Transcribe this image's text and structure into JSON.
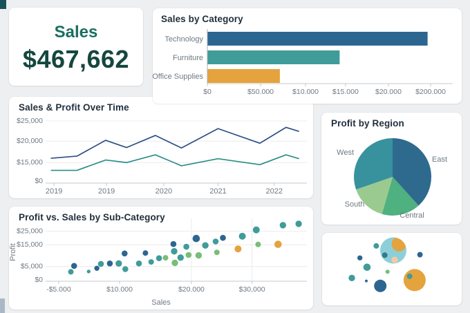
{
  "colors": {
    "darkblue": "#2d6591",
    "teal": "#3f9c98",
    "green": "#79bd77",
    "orange": "#e5a33d",
    "cyan": "#8ccfd9",
    "peach": "#f4caa2",
    "darkteal": "#35798c",
    "navy_line": "#2b4f85",
    "teal_line": "#2a8f86",
    "kpi_label": "#1c6f5f",
    "kpi_value": "#15473f"
  },
  "chart_data": [
    {
      "id": "kpi-sales",
      "type": "kpi",
      "title": "Sales",
      "value": "$467,662"
    },
    {
      "id": "sales-by-category",
      "type": "bar",
      "orientation": "horizontal",
      "title": "Sales by Category",
      "categories": [
        "Technology",
        "Furniture",
        "Office Supplies"
      ],
      "values": [
        195000,
        117000,
        64000
      ],
      "bar_colors": [
        "darkblue",
        "teal",
        "orange"
      ],
      "xlim": [
        0,
        217600
      ],
      "x_tick_labels": [
        "$0",
        "$50.000",
        "$10.000",
        "$15.000",
        "$20.000",
        "$200.000"
      ],
      "grid": false
    },
    {
      "id": "sales-profit-over-time",
      "type": "line",
      "title": "Sales & Profit Over Time",
      "x_tick_labels": [
        "2019",
        "2019",
        "2020",
        "2021",
        "2022"
      ],
      "y_tick_labels": [
        "$25,000",
        "$20,000",
        "$15,000",
        "$0"
      ],
      "y_tick_values": [
        25000,
        20000,
        15000,
        0
      ],
      "series": [
        {
          "name": "Sales",
          "color": "navy_line",
          "values": [
            16000,
            16500,
            20200,
            18500,
            21400,
            18400,
            23100,
            19500,
            23400,
            22400
          ]
        },
        {
          "name": "Profit",
          "color": "teal_line",
          "values": [
            8700,
            8700,
            15600,
            15000,
            16800,
            12400,
            15900,
            13300,
            16800,
            15900
          ]
        }
      ],
      "grid": true
    },
    {
      "id": "profit-by-region",
      "type": "pie",
      "title": "Profit by Region",
      "slices": [
        {
          "label": "East",
          "color": "darkblue",
          "start_deg": 0,
          "end_deg": 138,
          "pct": 38.3
        },
        {
          "label": "Central",
          "color": "green2",
          "start_deg": 138,
          "end_deg": 196,
          "pct": 16.1
        },
        {
          "label": "South",
          "color": "green3",
          "start_deg": 196,
          "end_deg": 251,
          "pct": 15.3
        },
        {
          "label": "West",
          "color": "teal2",
          "start_deg": 251,
          "end_deg": 360,
          "pct": 30.3
        }
      ],
      "slice_colors": {
        "darkblue": "#2e6a8e",
        "green2": "#4fb080",
        "green3": "#9aca90",
        "teal2": "#37929e"
      }
    },
    {
      "id": "profit-vs-sales",
      "type": "scatter",
      "title": "Profit vs. Sales by Sub-Category",
      "xlabel": "Sales",
      "ylabel": "Profit",
      "x_tick_labels": [
        "-$5.000",
        "$10.000",
        "$20.000",
        "$30,000"
      ],
      "x_tick_values": [
        -5000,
        10000,
        20000,
        30000
      ],
      "y_tick_labels": [
        "$25,000",
        "$15,000",
        "$5,000",
        "$0"
      ],
      "y_tick_values": [
        25000,
        15000,
        5000,
        0
      ],
      "point_format": [
        "sales",
        "profit",
        "color",
        "radius_px"
      ],
      "points": [
        [
          -2000,
          3200,
          "teal",
          4
        ],
        [
          -1200,
          5300,
          "darkblue",
          4.3
        ],
        [
          2400,
          3300,
          "teal",
          2.7
        ],
        [
          4400,
          4400,
          "darkblue",
          3.7
        ],
        [
          5400,
          6200,
          "teal",
          4.3
        ],
        [
          7600,
          6400,
          "darkblue",
          4.3
        ],
        [
          9800,
          6400,
          "teal",
          4.7
        ],
        [
          10800,
          4100,
          "teal",
          4.3
        ],
        [
          10700,
          11000,
          "darkblue",
          4.3
        ],
        [
          12700,
          6400,
          "teal",
          4.3
        ],
        [
          13600,
          11200,
          "darkblue",
          4
        ],
        [
          14400,
          7100,
          "teal",
          4
        ],
        [
          15500,
          8800,
          "teal",
          4.3
        ],
        [
          16400,
          9000,
          "green",
          4
        ],
        [
          17500,
          15500,
          "darkblue",
          4.3
        ],
        [
          17600,
          12000,
          "teal",
          4.7
        ],
        [
          17700,
          6700,
          "green",
          4.7
        ],
        [
          18500,
          9100,
          "teal",
          4.7
        ],
        [
          19300,
          14100,
          "teal",
          4.3
        ],
        [
          19600,
          10300,
          "green",
          4.3
        ],
        [
          20800,
          19600,
          "darkblue",
          5.3
        ],
        [
          21200,
          10100,
          "green",
          4.7
        ],
        [
          22300,
          14700,
          "teal",
          4.7
        ],
        [
          24000,
          17400,
          "teal",
          4.3
        ],
        [
          25200,
          20100,
          "darkblue",
          4.3
        ],
        [
          24200,
          11500,
          "green",
          4
        ],
        [
          27700,
          13100,
          "orange",
          5
        ],
        [
          28400,
          21300,
          "teal",
          5
        ],
        [
          30700,
          26000,
          "teal",
          5
        ],
        [
          31000,
          15200,
          "green",
          4
        ],
        [
          34300,
          15300,
          "orange",
          5.3
        ],
        [
          35100,
          29500,
          "teal",
          4.7
        ],
        [
          37700,
          30500,
          "teal",
          4.7
        ]
      ]
    },
    {
      "id": "packed-bubbles",
      "type": "bubble",
      "bubble_format": [
        "x_pct",
        "y_pct",
        "radius_px",
        "color"
      ],
      "bubbles": [
        [
          38.8,
          18.0,
          4.0,
          "teal",
          false
        ],
        [
          51.0,
          24.3,
          19.0,
          "cyan",
          false
        ],
        [
          55.1,
          15.4,
          10.7,
          "orange",
          true
        ],
        [
          44.9,
          30.8,
          4.0,
          "darkteal",
          false
        ],
        [
          52.0,
          37.2,
          4.7,
          "peach",
          false
        ],
        [
          27.1,
          34.6,
          3.7,
          "darkblue",
          false
        ],
        [
          32.2,
          47.4,
          5.3,
          "teal",
          false
        ],
        [
          21.3,
          62.2,
          4.7,
          "teal",
          false
        ],
        [
          31.7,
          66.3,
          2.0,
          "darkblue",
          false
        ],
        [
          46.9,
          53.6,
          3.0,
          "green",
          false
        ],
        [
          41.7,
          73.1,
          9.0,
          "darkblue",
          false
        ],
        [
          66.3,
          65.1,
          16.0,
          "orange",
          false
        ],
        [
          62.7,
          59.9,
          4.0,
          "teal",
          false
        ],
        [
          70.1,
          30.1,
          4.0,
          "darkblue",
          false
        ]
      ]
    }
  ]
}
